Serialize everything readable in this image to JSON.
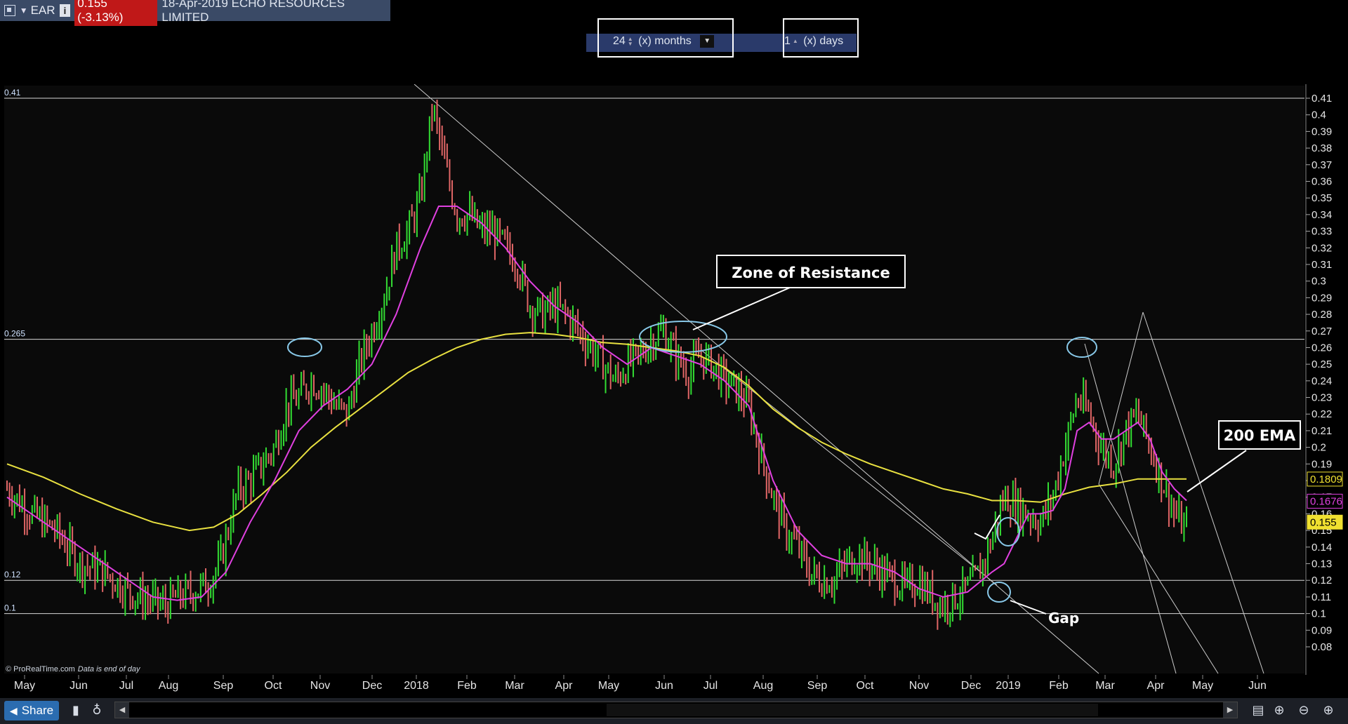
{
  "header": {
    "symbol": "EAR",
    "info_label": "i",
    "price_change": "0.155 (-3.13%)",
    "title": "18-Apr-2019 ECHO RESOURCES LIMITED"
  },
  "period": {
    "months_value": "24",
    "months_label": "(x) months",
    "days_value": "1",
    "days_label": "(x) days"
  },
  "footer": {
    "share_label": "Share",
    "credit": "© ProRealTime.com",
    "data_note": "Data is end of day"
  },
  "colors": {
    "background": "#0a0a0a",
    "up_bar": "#33dd33",
    "down_bar": "#e06666",
    "ema_fast": "#e040e0",
    "ema_200": "#e8e040",
    "annotation_circle": "#88c8e8",
    "last_price_badge": "#f0e030"
  },
  "chart_data": {
    "type": "bar",
    "ylim": [
      0.075,
      0.415
    ],
    "y_ticks": [
      "0.41",
      "0.4",
      "0.39",
      "0.38",
      "0.37",
      "0.36",
      "0.35",
      "0.34",
      "0.33",
      "0.32",
      "0.31",
      "0.3",
      "0.29",
      "0.28",
      "0.27",
      "0.26",
      "0.25",
      "0.24",
      "0.23",
      "0.22",
      "0.21",
      "0.2",
      "0.19",
      "0.18",
      "0.17",
      "0.16",
      "0.15",
      "0.14",
      "0.13",
      "0.12",
      "0.11",
      "0.1",
      "0.09",
      "0.08"
    ],
    "x_labels": [
      "May",
      "Jun",
      "Jul",
      "Aug",
      "Sep",
      "Oct",
      "Nov",
      "Dec",
      "2018",
      "Feb",
      "Mar",
      "Apr",
      "May",
      "Jun",
      "Jul",
      "Aug",
      "Sep",
      "Oct",
      "Nov",
      "Dec",
      "2019",
      "Feb",
      "Mar",
      "Apr",
      "May",
      "Jun"
    ],
    "horizontal_levels": [
      {
        "label": "0.41",
        "value": 0.41
      },
      {
        "label": "0.265",
        "value": 0.265
      },
      {
        "label": "0.12",
        "value": 0.12
      },
      {
        "label": "0.1",
        "value": 0.1
      }
    ],
    "last_values": [
      {
        "label": "0.1809",
        "value": 0.1809,
        "series": "200 EMA"
      },
      {
        "label": "0.1676",
        "value": 0.1676,
        "series": "fast EMA"
      },
      {
        "label": "0.155",
        "value": 0.155,
        "series": "price"
      }
    ],
    "annotations": [
      {
        "text": "Zone of Resistance"
      },
      {
        "text": "200 EMA"
      },
      {
        "text": "Gap"
      }
    ],
    "price_path": [
      [
        0,
        0.175
      ],
      [
        2,
        0.16
      ],
      [
        4,
        0.15
      ],
      [
        6,
        0.13
      ],
      [
        8,
        0.125
      ],
      [
        10,
        0.113
      ],
      [
        11.5,
        0.108
      ],
      [
        13,
        0.105
      ],
      [
        14,
        0.11
      ],
      [
        15,
        0.112
      ],
      [
        16.5,
        0.118
      ],
      [
        17.5,
        0.13
      ],
      [
        19,
        0.175
      ],
      [
        20,
        0.18
      ],
      [
        21,
        0.19
      ],
      [
        22,
        0.2
      ],
      [
        23,
        0.225
      ],
      [
        24,
        0.23
      ],
      [
        25,
        0.24
      ],
      [
        26,
        0.235
      ],
      [
        27,
        0.225
      ],
      [
        28,
        0.22
      ],
      [
        29,
        0.25
      ],
      [
        30,
        0.27
      ],
      [
        31,
        0.29
      ],
      [
        32,
        0.32
      ],
      [
        33,
        0.33
      ],
      [
        34,
        0.35
      ],
      [
        35,
        0.405
      ],
      [
        36,
        0.37
      ],
      [
        37,
        0.34
      ],
      [
        38,
        0.34
      ],
      [
        39,
        0.33
      ],
      [
        40,
        0.33
      ],
      [
        41,
        0.32
      ],
      [
        42,
        0.31
      ],
      [
        43,
        0.285
      ],
      [
        44,
        0.28
      ],
      [
        45,
        0.285
      ],
      [
        46,
        0.28
      ],
      [
        47,
        0.27
      ],
      [
        48,
        0.26
      ],
      [
        49,
        0.25
      ],
      [
        50,
        0.24
      ],
      [
        51,
        0.25
      ],
      [
        52,
        0.255
      ],
      [
        53,
        0.265
      ],
      [
        54,
        0.27
      ],
      [
        55,
        0.255
      ],
      [
        56,
        0.245
      ],
      [
        57,
        0.255
      ],
      [
        58,
        0.25
      ],
      [
        59,
        0.24
      ],
      [
        60,
        0.235
      ],
      [
        61,
        0.225
      ],
      [
        62,
        0.195
      ],
      [
        63,
        0.17
      ],
      [
        64,
        0.15
      ],
      [
        65,
        0.14
      ],
      [
        66,
        0.125
      ],
      [
        67,
        0.12
      ],
      [
        68,
        0.12
      ],
      [
        69,
        0.13
      ],
      [
        70,
        0.135
      ],
      [
        71,
        0.13
      ],
      [
        72,
        0.125
      ],
      [
        73,
        0.12
      ],
      [
        74,
        0.115
      ],
      [
        75,
        0.12
      ],
      [
        76,
        0.11
      ],
      [
        77,
        0.105
      ],
      [
        78,
        0.11
      ],
      [
        79,
        0.115
      ],
      [
        80,
        0.125
      ],
      [
        81,
        0.145
      ],
      [
        82,
        0.17
      ],
      [
        83,
        0.165
      ],
      [
        84,
        0.16
      ],
      [
        85,
        0.155
      ],
      [
        86,
        0.17
      ],
      [
        87,
        0.2
      ],
      [
        88,
        0.23
      ],
      [
        89,
        0.22
      ],
      [
        90,
        0.2
      ],
      [
        91,
        0.19
      ],
      [
        92,
        0.21
      ],
      [
        93,
        0.22
      ],
      [
        94,
        0.2
      ],
      [
        95,
        0.18
      ],
      [
        96,
        0.16
      ],
      [
        97,
        0.15
      ]
    ],
    "ema_fast_path": [
      [
        0,
        0.17
      ],
      [
        3,
        0.155
      ],
      [
        6,
        0.14
      ],
      [
        9,
        0.125
      ],
      [
        12,
        0.11
      ],
      [
        14,
        0.108
      ],
      [
        16,
        0.11
      ],
      [
        18,
        0.125
      ],
      [
        20,
        0.155
      ],
      [
        22,
        0.18
      ],
      [
        24,
        0.21
      ],
      [
        26,
        0.225
      ],
      [
        28,
        0.235
      ],
      [
        30,
        0.25
      ],
      [
        32,
        0.28
      ],
      [
        34,
        0.32
      ],
      [
        35.5,
        0.345
      ],
      [
        37,
        0.345
      ],
      [
        39,
        0.335
      ],
      [
        41,
        0.32
      ],
      [
        43,
        0.3
      ],
      [
        45,
        0.285
      ],
      [
        47,
        0.275
      ],
      [
        49,
        0.26
      ],
      [
        51,
        0.25
      ],
      [
        53,
        0.26
      ],
      [
        55,
        0.255
      ],
      [
        57,
        0.25
      ],
      [
        59,
        0.24
      ],
      [
        61,
        0.225
      ],
      [
        63,
        0.18
      ],
      [
        65,
        0.15
      ],
      [
        67,
        0.135
      ],
      [
        69,
        0.13
      ],
      [
        71,
        0.13
      ],
      [
        73,
        0.125
      ],
      [
        75,
        0.115
      ],
      [
        77,
        0.11
      ],
      [
        79,
        0.113
      ],
      [
        81,
        0.125
      ],
      [
        82,
        0.13
      ],
      [
        83,
        0.145
      ],
      [
        84,
        0.16
      ],
      [
        85,
        0.16
      ],
      [
        86,
        0.162
      ],
      [
        87,
        0.175
      ],
      [
        88,
        0.21
      ],
      [
        89,
        0.215
      ],
      [
        90,
        0.205
      ],
      [
        91,
        0.205
      ],
      [
        92,
        0.21
      ],
      [
        93,
        0.215
      ],
      [
        94,
        0.205
      ],
      [
        95,
        0.185
      ],
      [
        96,
        0.175
      ],
      [
        97,
        0.168
      ]
    ],
    "ema_200_path": [
      [
        0,
        0.19
      ],
      [
        3,
        0.182
      ],
      [
        6,
        0.172
      ],
      [
        9,
        0.163
      ],
      [
        12,
        0.155
      ],
      [
        15,
        0.15
      ],
      [
        17,
        0.152
      ],
      [
        19,
        0.16
      ],
      [
        21,
        0.172
      ],
      [
        23,
        0.185
      ],
      [
        25,
        0.2
      ],
      [
        27,
        0.212
      ],
      [
        29,
        0.223
      ],
      [
        31,
        0.234
      ],
      [
        33,
        0.245
      ],
      [
        35,
        0.253
      ],
      [
        37,
        0.26
      ],
      [
        39,
        0.265
      ],
      [
        41,
        0.268
      ],
      [
        43,
        0.269
      ],
      [
        45,
        0.268
      ],
      [
        47,
        0.266
      ],
      [
        49,
        0.263
      ],
      [
        51,
        0.262
      ],
      [
        53,
        0.26
      ],
      [
        55,
        0.258
      ],
      [
        57,
        0.255
      ],
      [
        59,
        0.248
      ],
      [
        61,
        0.237
      ],
      [
        63,
        0.223
      ],
      [
        65,
        0.212
      ],
      [
        67,
        0.203
      ],
      [
        69,
        0.196
      ],
      [
        71,
        0.19
      ],
      [
        73,
        0.185
      ],
      [
        75,
        0.18
      ],
      [
        77,
        0.175
      ],
      [
        79,
        0.172
      ],
      [
        81,
        0.168
      ],
      [
        83,
        0.168
      ],
      [
        85,
        0.167
      ],
      [
        87,
        0.172
      ],
      [
        89,
        0.176
      ],
      [
        91,
        0.178
      ],
      [
        93,
        0.181
      ],
      [
        95,
        0.181
      ],
      [
        97,
        0.181
      ]
    ]
  }
}
